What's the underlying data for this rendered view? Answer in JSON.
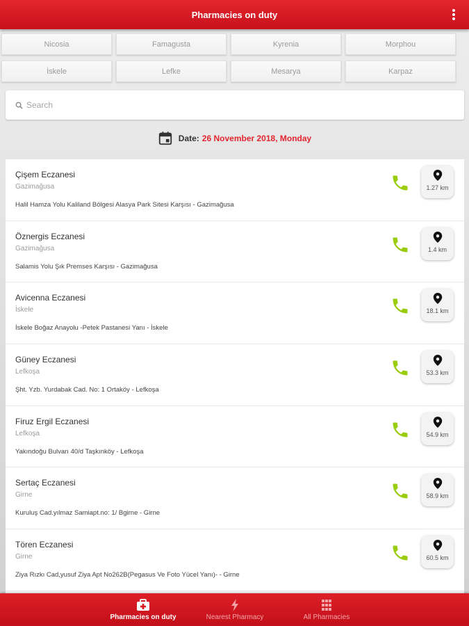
{
  "app": {
    "title": "Pharmacies on duty"
  },
  "cities": [
    "Nicosia",
    "Famagusta",
    "Kyrenia",
    "Morphou",
    "İskele",
    "Lefke",
    "Mesarya",
    "Karpaz"
  ],
  "search": {
    "placeholder": "Search",
    "value": ""
  },
  "date": {
    "label": "Date:",
    "value": "26 November 2018, Monday"
  },
  "pharmacies": [
    {
      "name": "Çişem Eczanesi",
      "city": "Gazimağusa",
      "address": "Halil Hamza Yolu Kaliland Bölgesi Alasya Park Sitesi Karşısı - Gazimağusa",
      "distance": "1.27 km"
    },
    {
      "name": "Öznergis Eczanesi",
      "city": "Gazimağusa",
      "address": "Salamis Yolu Şık Premses Karşısı - Gazimağusa",
      "distance": "1.4 km"
    },
    {
      "name": "Avicenna Eczanesi",
      "city": "İskele",
      "address": "İskele Boğaz Anayolu -Petek Pastanesi Yanı - İskele",
      "distance": "18.1 km"
    },
    {
      "name": "Güney Eczanesi",
      "city": "Lefkoşa",
      "address": "Şht. Yzb. Yurdabak Cad. No: 1 Ortaköy - Lefkoşa",
      "distance": "53.3 km"
    },
    {
      "name": "Firuz Ergil Eczanesi",
      "city": "Lefkoşa",
      "address": "Yakındoğu Bulvarı 40/d Taşkınköy - Lefkoşa",
      "distance": "54.9 km"
    },
    {
      "name": "Sertaç Eczanesi",
      "city": "Girne",
      "address": "Kuruluş Cad.yılmaz Samiapt.no: 1/ Bgirne - Girne",
      "distance": "58.9 km"
    },
    {
      "name": "Tören Eczanesi",
      "city": "Girne",
      "address": "Ziya Rızkı Cad,yusuf Ziya Apt No262B(Pegasus Ve Foto Yücel Yanı)- - Girne",
      "distance": "60.5 km"
    }
  ],
  "nav": {
    "duty": "Pharmacies on duty",
    "nearest": "Nearest Pharmacy",
    "all": "All Pharmacies"
  },
  "colors": {
    "brand": "#d8161f",
    "phone": "#9acd0f",
    "date_value": "#e3262f"
  },
  "icons": {
    "menu": "more-vert-icon",
    "search": "search-icon",
    "calendar": "calendar-icon",
    "phone": "phone-icon",
    "location": "location-pin-icon",
    "duty": "medical-kit-icon",
    "nearest": "lightning-icon",
    "all": "grid-icon"
  }
}
